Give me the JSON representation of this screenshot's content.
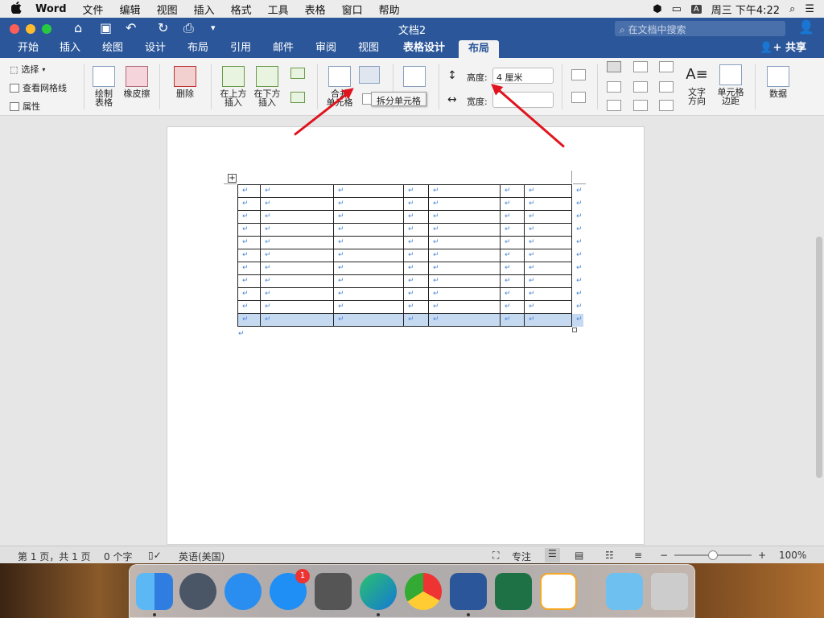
{
  "menubar": {
    "apple": "",
    "app": "Word",
    "items": [
      "文件",
      "编辑",
      "视图",
      "插入",
      "格式",
      "工具",
      "表格",
      "窗口",
      "帮助"
    ],
    "input_badge": "A",
    "clock": "周三 下午4:22"
  },
  "titlebar": {
    "title": "文档2",
    "search_placeholder": "在文档中搜索"
  },
  "tabs": [
    "开始",
    "插入",
    "绘图",
    "设计",
    "布局",
    "引用",
    "邮件",
    "审阅",
    "视图",
    "表格设计",
    "布局"
  ],
  "active_tab_index": 10,
  "share": "共享",
  "ribbon": {
    "select": "选择",
    "view_gridlines": "查看网格线",
    "properties": "属性",
    "draw_table_1": "绘制",
    "draw_table_2": "表格",
    "eraser": "橡皮擦",
    "delete": "删除",
    "insert_above_1": "在上方",
    "insert_above_2": "插入",
    "insert_below_1": "在下方",
    "insert_below_2": "插入",
    "merge_1": "合并",
    "merge_2": "单元格",
    "height_label": "高度:",
    "height_value": "4 厘米",
    "width_label": "宽度:",
    "width_value": "",
    "text_direction_1": "文字",
    "text_direction_2": "方向",
    "cell_margins_1": "单元格",
    "cell_margins_2": "边距",
    "data": "数据"
  },
  "tooltip": "拆分单元格",
  "table": {
    "rows": 11,
    "cols": 8,
    "cell_mark": "↵",
    "highlighted_row": 10
  },
  "statusbar": {
    "page": "第 1 页，共 1 页",
    "words": "0 个字",
    "language": "英语(美国)",
    "focus": "专注",
    "zoom": "100%"
  },
  "dock": [
    "Finder",
    "Launchpad",
    "Safari",
    "App Store",
    "系统偏好设置",
    "Edge",
    "Chrome",
    "Word",
    "Excel",
    "Sketchbook",
    "文件夹",
    "废纸篓"
  ],
  "dock_badge": "1",
  "colors": {
    "word_blue": "#2b579a",
    "annotation_red": "#e0141e",
    "selection": "#c5d9f1"
  }
}
